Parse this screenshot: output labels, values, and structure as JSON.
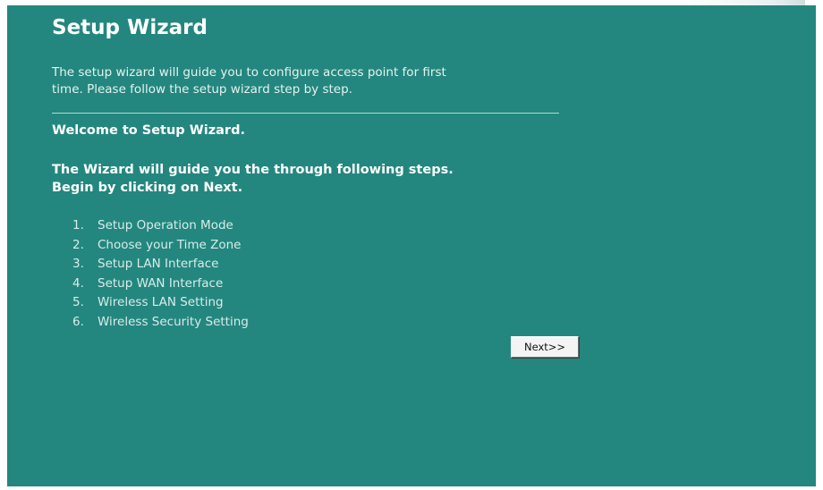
{
  "wizard": {
    "title": "Setup Wizard",
    "intro_line1": "The setup wizard will guide you to configure access point for first",
    "intro_line2": "time. Please follow the setup wizard step by step.",
    "welcome": "Welcome to Setup Wizard.",
    "guide_line1": "The Wizard will guide you the through following steps.",
    "guide_line2": "Begin by clicking on Next.",
    "steps": [
      {
        "number": "1.",
        "label": "Setup Operation Mode"
      },
      {
        "number": "2.",
        "label": "Choose your Time Zone"
      },
      {
        "number": "3.",
        "label": "Setup LAN Interface"
      },
      {
        "number": "4.",
        "label": "Setup WAN Interface"
      },
      {
        "number": "5.",
        "label": "Wireless LAN Setting"
      },
      {
        "number": "6.",
        "label": "Wireless Security Setting"
      }
    ],
    "next_label": "Next>>"
  },
  "colors": {
    "panel_background": "#23877f",
    "text": "#ffffff",
    "button_face": "#f4f4f4"
  }
}
